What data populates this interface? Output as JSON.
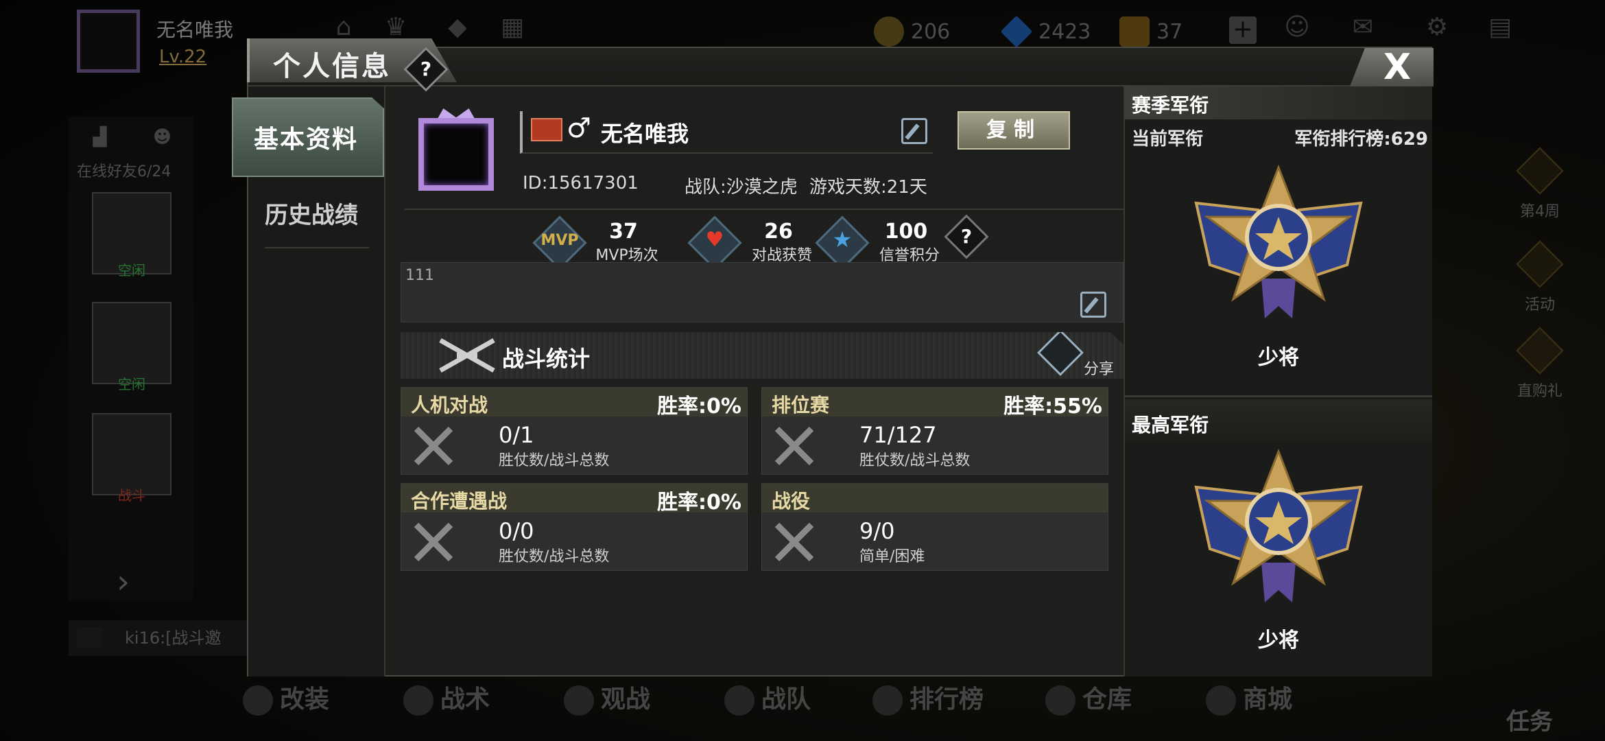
{
  "player": {
    "name": "无名唯我",
    "level": "Lv.22"
  },
  "resources": {
    "gold": "206",
    "diamonds": "2423",
    "tickets": "37"
  },
  "side_panel": {
    "online_friends": "在线好友6/24",
    "friends": [
      {
        "status": "空闲",
        "status_color": "#39b34a"
      },
      {
        "status": "空闲",
        "status_color": "#39b34a"
      },
      {
        "status": "战斗",
        "status_color": "#c03a2b"
      }
    ]
  },
  "chat": {
    "preview": "ki16:[战斗邀"
  },
  "right_side": {
    "week": "第4周",
    "activity": "活动",
    "purchase": "直购礼"
  },
  "bottom_nav": [
    "改装",
    "战术",
    "观战",
    "战队",
    "排行榜",
    "仓库",
    "商城"
  ],
  "task_label": "任务",
  "modal": {
    "title": "个人信息",
    "help": "?",
    "close": "X",
    "tabs": {
      "basic": "基本资料",
      "history": "历史战绩"
    },
    "profile": {
      "name": "无名唯我",
      "gender_symbol": "♂",
      "copy_label": "复制",
      "id": "ID:15617301",
      "team": "战队:沙漠之虎",
      "days": "游戏天数:21天"
    },
    "badges": [
      {
        "icon": "MVP",
        "value": "37",
        "label": "MVP场次",
        "color": "#d4b04a"
      },
      {
        "icon": "♥",
        "value": "26",
        "label": "对战获赞",
        "color": "#e5392a"
      },
      {
        "icon": "★",
        "value": "100",
        "label": "信誉积分",
        "color": "#4aa3e0"
      }
    ],
    "bio": "111",
    "battle_stats": {
      "title": "战斗统计",
      "share": "分享"
    },
    "modes": [
      {
        "mode": "人机对战",
        "rate": "胜率:0%",
        "ratio": "0/1",
        "desc": "胜仗数/战斗总数"
      },
      {
        "mode": "排位赛",
        "rate": "胜率:55%",
        "ratio": "71/127",
        "desc": "胜仗数/战斗总数"
      },
      {
        "mode": "合作遭遇战",
        "rate": "胜率:0%",
        "ratio": "0/0",
        "desc": "胜仗数/战斗总数"
      },
      {
        "mode": "战役",
        "rate": "",
        "ratio": "9/0",
        "desc": "简单/困难"
      }
    ],
    "rank": {
      "header": "赛季军衔",
      "current_label": "当前军衔",
      "leaderboard": "军衔排行榜:629",
      "current_rank": "少将",
      "highest_label": "最高军衔",
      "highest_rank": "少将"
    }
  },
  "colors": {
    "accent_gold": "#c9a55a",
    "panel_bg": "#1e1f1d",
    "medal_blue": "#2c3f8a",
    "medal_gold": "#c9a25a"
  }
}
